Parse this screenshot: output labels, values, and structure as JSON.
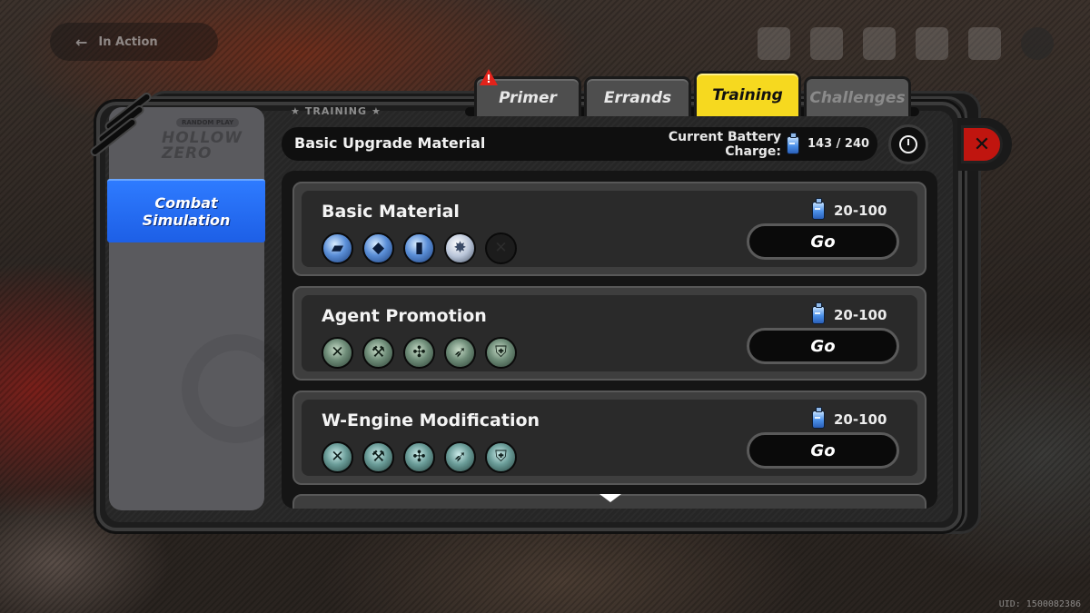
{
  "hud": {
    "back_label": "In Action",
    "uid": "UID: 1500082386"
  },
  "sidebar": {
    "logo_badge": "RANDOM PLAY",
    "logo_text": "HOLLOW\nZERO",
    "active_item": "Combat\nSimulation"
  },
  "tabs": [
    {
      "label": "Primer",
      "state": "normal",
      "has_alert": true
    },
    {
      "label": "Errands",
      "state": "normal",
      "has_alert": false
    },
    {
      "label": "Training",
      "state": "active",
      "has_alert": false
    },
    {
      "label": "Challenges",
      "state": "disabled",
      "has_alert": false
    }
  ],
  "alert_badge": "!",
  "header": {
    "section_label": "TRAINING",
    "title": "Basic Upgrade Material",
    "battery_label": "Current Battery\nCharge:",
    "battery_value": "143 / 240"
  },
  "cards": [
    {
      "title": "Basic Material",
      "cost": "20-100",
      "go_label": "Go",
      "items": [
        {
          "icon": "chip-icon",
          "style": "blue",
          "glyph": "▰"
        },
        {
          "icon": "tank-icon",
          "style": "blue",
          "glyph": "◆"
        },
        {
          "icon": "battery-icon",
          "style": "blue",
          "glyph": "▮"
        },
        {
          "icon": "gear-icon",
          "style": "silver",
          "glyph": "✸"
        },
        {
          "icon": "locked-slot-icon",
          "style": "empty",
          "glyph": "✕"
        }
      ]
    },
    {
      "title": "Agent Promotion",
      "cost": "20-100",
      "go_label": "Go",
      "items": [
        {
          "icon": "crossed-tools-icon",
          "style": "green",
          "glyph": "✕"
        },
        {
          "icon": "hammer-icon",
          "style": "green",
          "glyph": "⚒"
        },
        {
          "icon": "fan-icon",
          "style": "green",
          "glyph": "✣"
        },
        {
          "icon": "bullet-icon",
          "style": "green",
          "glyph": "➶"
        },
        {
          "icon": "shield-icon",
          "style": "green",
          "glyph": "⛨"
        }
      ]
    },
    {
      "title": "W-Engine Modification",
      "cost": "20-100",
      "go_label": "Go",
      "items": [
        {
          "icon": "crossed-tools-icon",
          "style": "teal",
          "glyph": "✕"
        },
        {
          "icon": "hammer-icon",
          "style": "teal",
          "glyph": "⚒"
        },
        {
          "icon": "fan-icon",
          "style": "teal",
          "glyph": "✣"
        },
        {
          "icon": "bullet-icon",
          "style": "teal",
          "glyph": "➶"
        },
        {
          "icon": "shield-icon",
          "style": "teal",
          "glyph": "⛨"
        }
      ]
    }
  ],
  "colors": {
    "accent_yellow": "#f6d91f",
    "sidebar_active_blue": "#2e7bff",
    "close_red": "#c0150f",
    "alert_red": "#e3231b"
  }
}
